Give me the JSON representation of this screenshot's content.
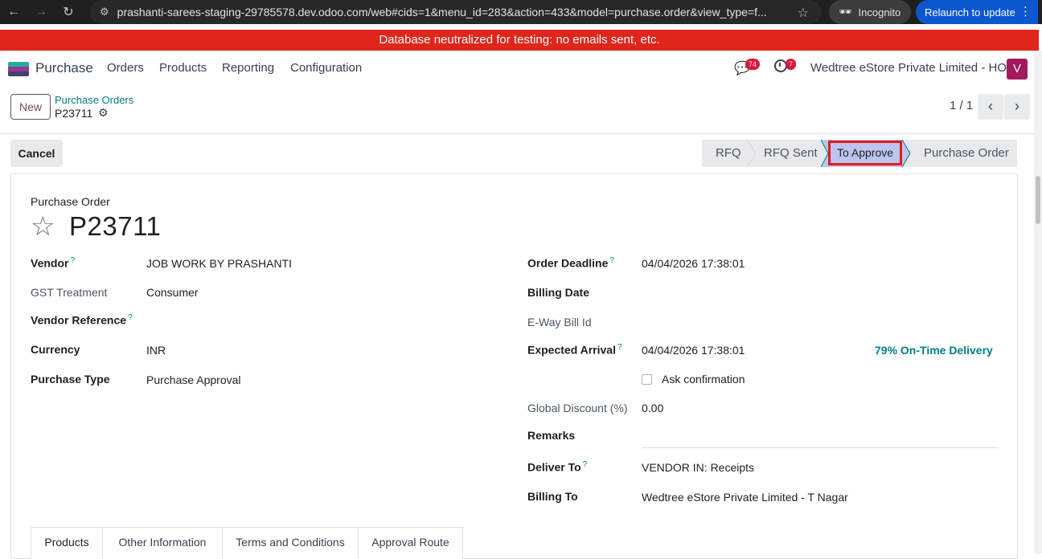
{
  "browser": {
    "url": "prashanti-sarees-staging-29785578.dev.odoo.com/web#cids=1&menu_id=283&action=433&model=purchase.order&view_type=f...",
    "incognito_label": "Incognito",
    "relaunch_label": "Relaunch to update"
  },
  "banner": "Database neutralized for testing: no emails sent, etc.",
  "navbar": {
    "app_name": "Purchase",
    "menu": [
      "Orders",
      "Products",
      "Reporting",
      "Configuration"
    ],
    "messages_count": "74",
    "activities_count": "7",
    "company": "Wedtree eStore Private Limited - HO",
    "avatar_letter": "V"
  },
  "control": {
    "new_label": "New",
    "breadcrumb_parent": "Purchase Orders",
    "breadcrumb_current": "P23711",
    "pager": "1 / 1"
  },
  "statusbar": {
    "cancel_label": "Cancel",
    "steps": [
      "RFQ",
      "RFQ Sent",
      "To Approve",
      "Purchase Order"
    ],
    "active_step": "To Approve"
  },
  "form": {
    "type_label": "Purchase Order",
    "name": "P23711",
    "left_fields": [
      {
        "label": "Vendor",
        "help": "?",
        "value": "JOB WORK BY PRASHANTI"
      },
      {
        "label": "GST Treatment",
        "value": "Consumer"
      },
      {
        "label": "Vendor Reference",
        "help": "?",
        "value": ""
      },
      {
        "label": "Currency",
        "value": "INR"
      },
      {
        "label": "Purchase Type",
        "value": "Purchase Approval"
      }
    ],
    "right_fields": {
      "order_deadline": {
        "label": "Order Deadline",
        "help": "?",
        "value": "04/04/2026 17:38:01"
      },
      "billing_date": {
        "label": "Billing Date",
        "value": ""
      },
      "eway_bill": {
        "label": "E-Way Bill Id",
        "value": ""
      },
      "expected_arrival": {
        "label": "Expected Arrival",
        "help": "?",
        "value": "04/04/2026 17:38:01"
      },
      "on_time_delivery": "79% On-Time Delivery",
      "ask_confirmation": "Ask confirmation",
      "global_discount": {
        "label": "Global Discount (%)",
        "value": "0.00"
      },
      "remarks": {
        "label": "Remarks",
        "value": ""
      },
      "deliver_to": {
        "label": "Deliver To",
        "help": "?",
        "value": "VENDOR IN: Receipts"
      },
      "billing_to": {
        "label": "Billing To",
        "value": "Wedtree eStore Private Limited - T Nagar"
      }
    }
  },
  "tabs": [
    "Products",
    "Other Information",
    "Terms and Conditions",
    "Approval Route"
  ]
}
